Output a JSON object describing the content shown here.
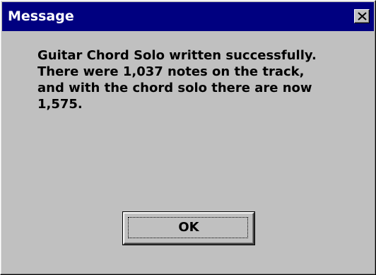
{
  "window": {
    "title": "Message",
    "title_bar_color": "#000080",
    "close_icon": "close-x-icon"
  },
  "message": {
    "lines": [
      "Guitar Chord Solo written successfully.",
      "There were 1,037 notes on the track,",
      "and with the chord solo there are now",
      "1,575."
    ]
  },
  "buttons": {
    "ok_label": "OK"
  }
}
